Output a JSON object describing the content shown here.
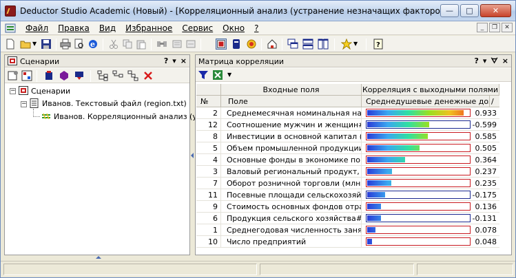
{
  "window": {
    "title": "Deductor Studio Academic (Новый) - [Корреляционный анализ (устранение незначащих факторов)]",
    "controls": [
      "minimize",
      "maximize",
      "close"
    ]
  },
  "menu": {
    "items": [
      "Файл",
      "Правка",
      "Вид",
      "Избранное",
      "Сервис",
      "Окно",
      "?"
    ]
  },
  "left_pane": {
    "title": "Сценарии",
    "header_buttons": [
      "?",
      "▾",
      "×"
    ],
    "tree": [
      {
        "label": "Сценарии",
        "level": 0,
        "icon": "scenarios-icon"
      },
      {
        "label": "Иванов. Текстовый файл (region.txt)",
        "level": 1,
        "icon": "text-file-icon"
      },
      {
        "label": "Иванов. Корреляционный анализ (устра",
        "level": 2,
        "icon": "correlation-icon"
      }
    ]
  },
  "right_pane": {
    "title": "Матрица корреляции",
    "header_buttons": [
      "?",
      "▾",
      "ᗊ",
      "×"
    ],
    "grid": {
      "group_headers": {
        "inputs": "Входные поля",
        "outputs": "Корреляция с выходными полями"
      },
      "col_headers": {
        "num": "№",
        "field": "Поле",
        "output": "Среднедушевые денежные доход...",
        "sort": "/"
      },
      "rows": [
        {
          "num": "2",
          "field": "Среднемесячная номинальная  на...",
          "value": 0.933,
          "text": "0.933"
        },
        {
          "num": "12",
          "field": "Соотношение мужчин и женщин# (...",
          "value": -0.599,
          "text": "-0.599"
        },
        {
          "num": "8",
          "field": "Инвестиции в основной капитал (...",
          "value": 0.585,
          "text": "0.585"
        },
        {
          "num": "5",
          "field": "Объем промышленной продукции (...",
          "value": 0.505,
          "text": "0.505"
        },
        {
          "num": "4",
          "field": "Основные фонды в экономике поп...",
          "value": 0.364,
          "text": "0.364"
        },
        {
          "num": "3",
          "field": "Валовый региональный продукт, (...",
          "value": 0.237,
          "text": "0.237"
        },
        {
          "num": "7",
          "field": "Оборот розничной торговли (млн#...",
          "value": 0.235,
          "text": "0.235"
        },
        {
          "num": "11",
          "field": "Посевные площади сельскохозяй...",
          "value": -0.175,
          "text": "-0.175"
        },
        {
          "num": "9",
          "field": "Стоимость основных фондов отра...",
          "value": 0.136,
          "text": "0.136"
        },
        {
          "num": "6",
          "field": "Продукция сельского хозяйства# ...",
          "value": -0.131,
          "text": "-0.131"
        },
        {
          "num": "1",
          "field": "Среднегодовая численность занят...",
          "value": 0.078,
          "text": "0.078"
        },
        {
          "num": "10",
          "field": "Число предприятий",
          "value": 0.048,
          "text": "0.048"
        }
      ]
    }
  },
  "colors": {
    "positive_border": "#c8181e",
    "negative_border": "#1a2890",
    "gradient": [
      "#2a3cd8",
      "#3aa8f0",
      "#30e0a0",
      "#9ae020",
      "#f0c020",
      "#f05020"
    ]
  }
}
